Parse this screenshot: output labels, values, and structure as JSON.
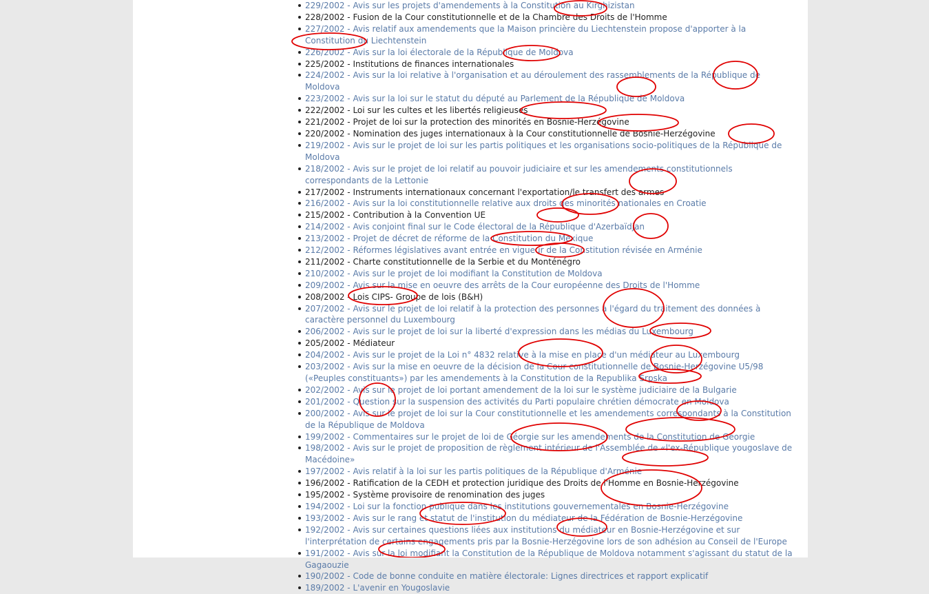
{
  "colors": {
    "link": "#5a7ba8",
    "text": "#222222",
    "annotation": "#e00000"
  },
  "items": [
    {
      "text": "229/2002 - Avis sur les projets d'amendements à la Constitution au Kirghizistan",
      "link": true
    },
    {
      "text": "228/2002 - Fusion de la Cour constitutionnelle et de la Chambre des Droits de l'Homme",
      "link": false
    },
    {
      "text": "227/2002 - Avis relatif aux amendements que la Maison princière du Liechtenstein propose d'apporter à la Constitution du Liechtenstein",
      "link": true
    },
    {
      "text": "226/2002 - Avis sur la loi électorale de la République de Moldova",
      "link": true
    },
    {
      "text": "225/2002 - Institutions de finances internationales",
      "link": false
    },
    {
      "text": "224/2002 - Avis sur la loi relative à l'organisation et au déroulement des rassemblements de la République de Moldova",
      "link": true
    },
    {
      "text": "223/2002 - Avis sur la loi sur le statut du député au Parlement de la République de Moldova",
      "link": true
    },
    {
      "text": "222/2002 - Loi sur les cultes et les libertés religieuses",
      "link": false
    },
    {
      "text": "221/2002 - Projet de loi sur la protection des minorités en Bosnie-Herzégovine",
      "link": false
    },
    {
      "text": "220/2002 - Nomination des juges internationaux à la Cour constitutionnelle de Bosnie-Herzégovine",
      "link": false
    },
    {
      "text": "219/2002 - Avis sur le projet de loi sur les partis politiques et les organisations socio-politiques de la République de Moldova",
      "link": true
    },
    {
      "text": "218/2002 - Avis sur le projet de loi relatif au pouvoir judiciaire et sur les amendements constitutionnels correspondants de la Lettonie",
      "link": true
    },
    {
      "text": "217/2002 - Instruments internationaux concernant l'exportation/le transfert des armes",
      "link": false
    },
    {
      "text": "216/2002 - Avis sur la loi constitutionnelle relative aux droits des minorités nationales en Croatie",
      "link": true
    },
    {
      "text": "215/2002 - Contribution à la Convention UE",
      "link": false
    },
    {
      "text": "214/2002 - Avis conjoint final sur le Code électoral de la République d'Azerbaïdjan",
      "link": true
    },
    {
      "text": "213/2002 - Projet de décret de réforme de la Constitution du Mexique",
      "link": true
    },
    {
      "text": "212/2002 - Réformes législatives avant entrée en vigueur de la Constitution révisée en Arménie",
      "link": true
    },
    {
      "text": "211/2002 - Charte constitutionnelle de la Serbie et du Monténégro",
      "link": false
    },
    {
      "text": "210/2002 - Avis sur le projet de loi modifiant la Constitution de Moldova",
      "link": true
    },
    {
      "text": "209/2002 - Avis sur la mise en oeuvre des arrêts de la Cour européenne des Droits de l'Homme",
      "link": true
    },
    {
      "text": "208/2002 - Lois CIPS- Groupe de lois (B&H)",
      "link": false
    },
    {
      "text": "207/2002 - Avis sur le projet de loi relatif à la protection des personnes à l'égard du traitement des données à caractère personnel du Luxembourg",
      "link": true
    },
    {
      "text": "206/2002 - Avis sur le projet de loi sur la liberté d'expression dans les médias du Luxembourg",
      "link": true
    },
    {
      "text": "205/2002 - Médiateur",
      "link": false
    },
    {
      "text": "204/2002 - Avis sur le projet de la Loi n° 4832 relative à la mise en place d'un médiateur au Luxembourg",
      "link": true
    },
    {
      "text": "203/2002 - Avis sur la mise en oeuvre de la décision de la Cour constitutionnelle de Bosnie-Herzégovine U5/98 («Peuples constituants») par les amendements à la Constitution de la Republika Srpska",
      "link": true
    },
    {
      "text": "202/2002 - Avis sur le projet de loi portant amendement de la loi sur le système judiciaire de la Bulgarie",
      "link": true
    },
    {
      "text": "201/2002 - Question sur la suspension des activités du Parti populaire chrétien démocrate en Moldova",
      "link": true
    },
    {
      "text": "200/2002 - Avis sur le projet de loi sur la Cour constitutionnelle et les amendements correspondants à la Constitution de la République de Moldova",
      "link": true
    },
    {
      "text": "199/2002 - Commentaires sur le projet de loi de Géorgie sur les amendements de la Constitution de Géorgie",
      "link": true
    },
    {
      "text": "198/2002 - Avis sur le projet de proposition de règlement intérieur de l'Assemblée de «l'ex-République yougoslave de Macédoine»",
      "link": true
    },
    {
      "text": "197/2002 - Avis relatif à la loi sur les partis politiques de la République d'Arménie",
      "link": true
    },
    {
      "text": "196/2002 - Ratification de la CEDH et protection juridique des Droits de l'Homme en Bosnie-Herzégovine",
      "link": false
    },
    {
      "text": "195/2002 - Système provisoire de renomination des juges",
      "link": false
    },
    {
      "text": "194/2002 - Loi sur la fonction publique dans les institutions gouvernementales en Bosnie-Herzégovine",
      "link": true
    },
    {
      "text": "193/2002 - Avis sur le rang et statut de l'institution du médiateur de la Fédération de Bosnie-Herzégovine",
      "link": true
    },
    {
      "text": "192/2002 - Avis sur certaines questions liées aux institutions du médiateur en Bosnie-Herzégovine et sur l'interprétation de certains engagements pris par la Bosnie-Herzégovine lors de son adhésion au Conseil de l'Europe",
      "link": true
    },
    {
      "text": "191/2002 - Avis sur la loi modifiant la Constitution de la République de Moldova notamment s'agissant du statut de la Gagaouzie",
      "link": true
    },
    {
      "text": "190/2002 - Code de bonne conduite en matière électorale: Lignes directrices et rapport explicatif",
      "link": true
    },
    {
      "text": "189/2002 - L'avenir en Yougoslavie",
      "link": true
    }
  ]
}
